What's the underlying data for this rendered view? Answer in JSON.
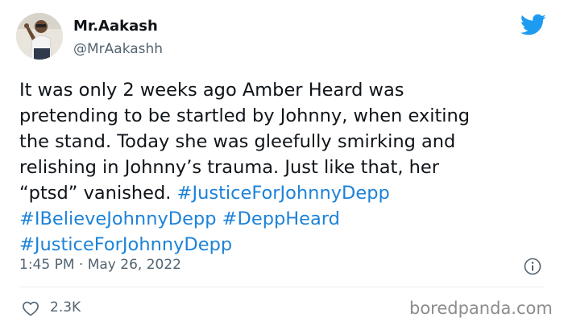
{
  "author": {
    "display_name": "Mr.Aakash",
    "handle": "@MrAakashh"
  },
  "tweet": {
    "lines": [
      [
        {
          "t": "It was only 2 weeks ago Amber Heard was",
          "h": false
        }
      ],
      [
        {
          "t": "pretending to be startled by Johnny, when exiting",
          "h": false
        }
      ],
      [
        {
          "t": "the stand. Today she was gleefully smirking and",
          "h": false
        }
      ],
      [
        {
          "t": "relishing in Johnny’s trauma. Just like that, her",
          "h": false
        }
      ],
      [
        {
          "t": "“ptsd” vanished. ",
          "h": false
        },
        {
          "t": "#JusticeForJohnnyDepp",
          "h": true
        }
      ],
      [
        {
          "t": " ",
          "h": false
        },
        {
          "t": "#IBelieveJohnnyDepp",
          "h": true
        },
        {
          "t": " ",
          "h": false
        },
        {
          "t": "#DeppHeard",
          "h": true
        }
      ],
      [
        {
          "t": " ",
          "h": false
        },
        {
          "t": "#JusticeForJohnnyDepp",
          "h": true
        }
      ]
    ]
  },
  "meta": {
    "timestamp": "1:45 PM · May 26, 2022"
  },
  "engagement": {
    "likes": "2.3K"
  },
  "watermark": "boredpanda.com",
  "icons": {
    "brand": "twitter-bird-icon",
    "info": "info-icon",
    "like": "heart-icon"
  },
  "colors": {
    "hashtag": "#1d82d8",
    "twitter_blue": "#1d9bf0",
    "secondary_text": "#536471",
    "primary_text": "#0f1419"
  }
}
